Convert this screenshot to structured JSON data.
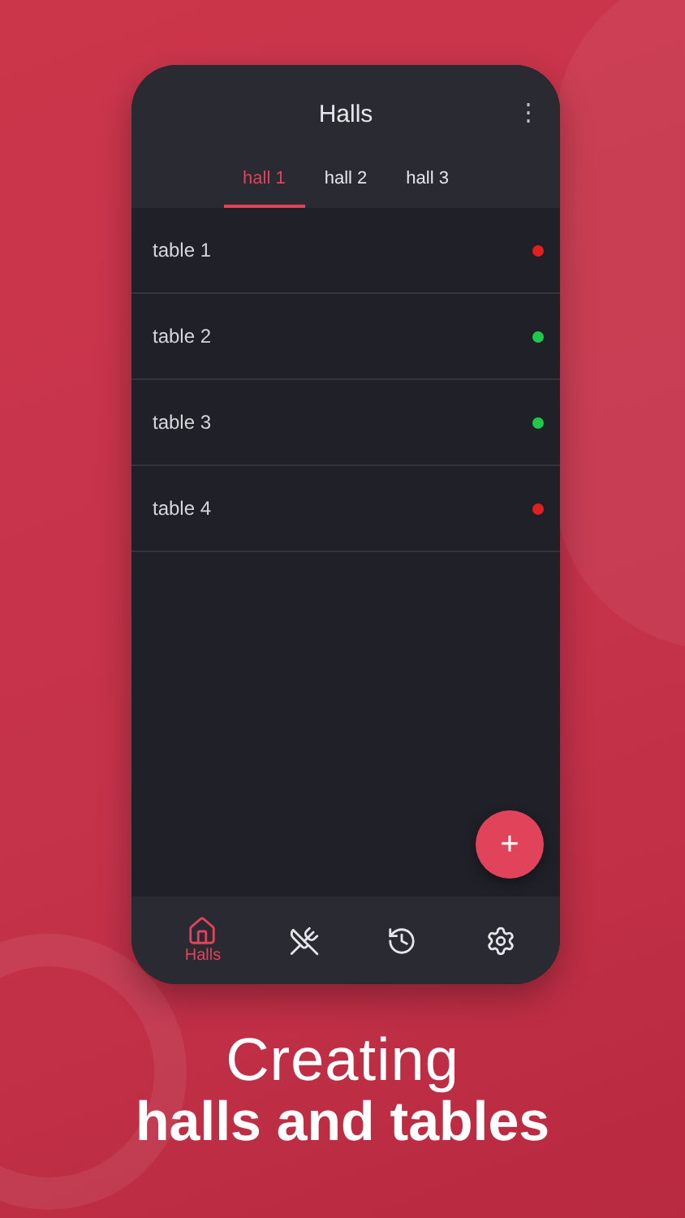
{
  "app_bar": {
    "title": "Halls",
    "menu": "⋮"
  },
  "tabs": [
    {
      "label": "hall 1",
      "selected": true
    },
    {
      "label": "hall 2",
      "selected": false
    },
    {
      "label": "hall 3",
      "selected": false
    }
  ],
  "tables": [
    {
      "name": "table 1",
      "color": "#e0201e"
    },
    {
      "name": "table 2",
      "color": "#1ec94a"
    },
    {
      "name": "table 3",
      "color": "#1ec94a"
    },
    {
      "name": "table 4",
      "color": "#e0201e"
    }
  ],
  "fab": {
    "label": "+"
  },
  "bottom_nav": [
    {
      "kind": "home",
      "label": "Halls",
      "selected": true
    },
    {
      "kind": "utensils",
      "selected": false
    },
    {
      "kind": "history",
      "selected": false
    },
    {
      "kind": "settings",
      "selected": false
    }
  ],
  "caption": {
    "line_1": "Creating",
    "line_2": "halls and tables"
  }
}
